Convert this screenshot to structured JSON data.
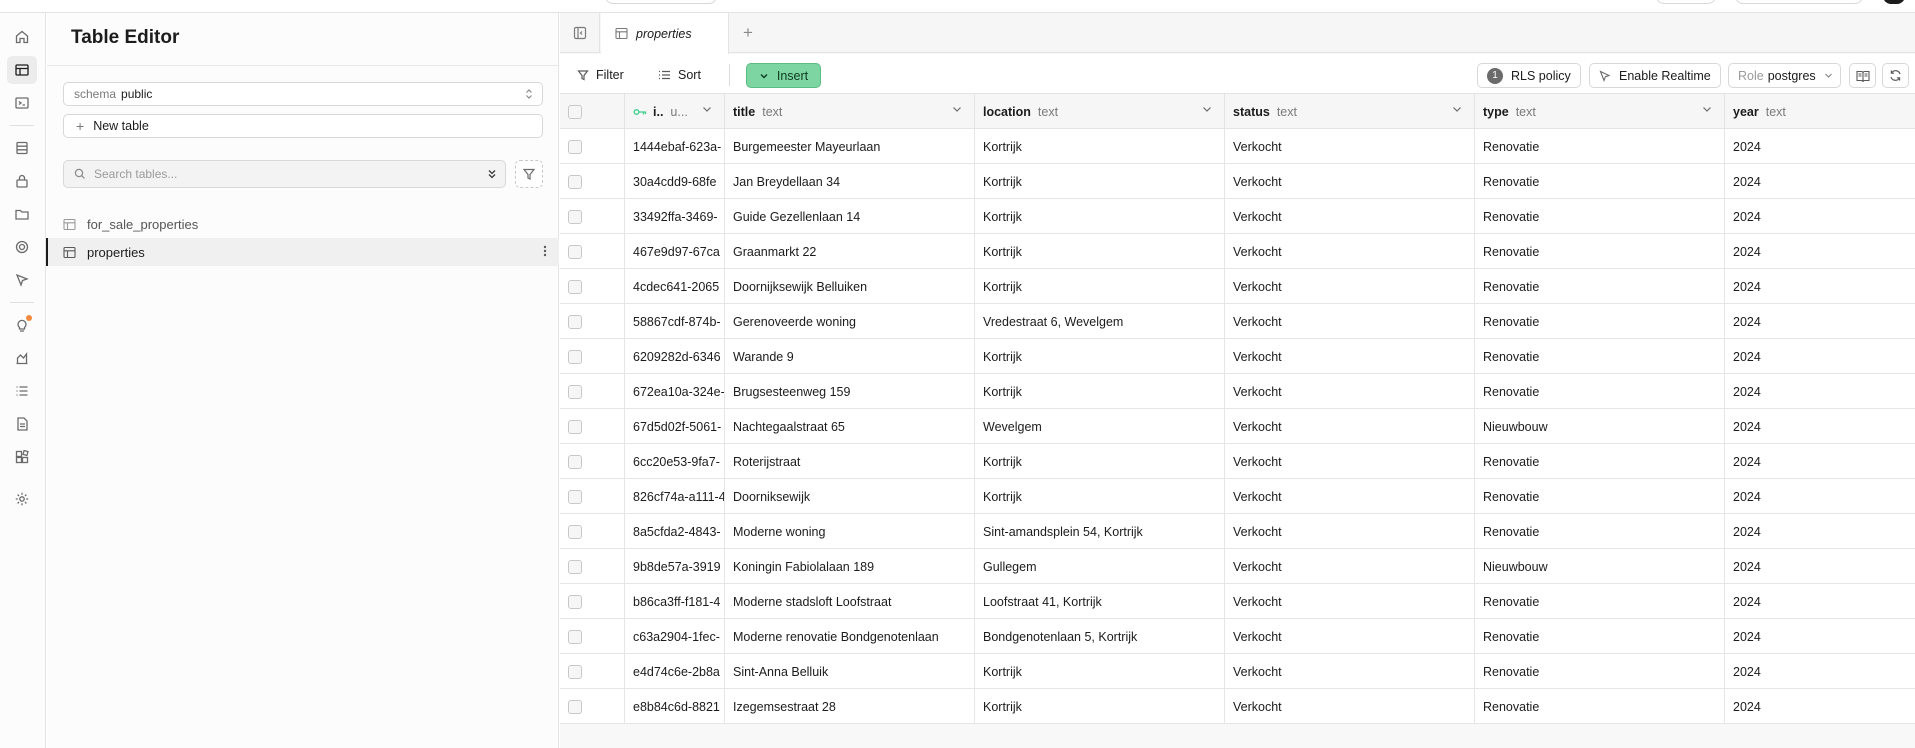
{
  "sidebar": {
    "title": "Table Editor",
    "schema_label": "schema",
    "schema_value": "public",
    "new_table_label": "New table",
    "search_placeholder": "Search tables...",
    "tables": [
      {
        "name": "for_sale_properties",
        "active": false
      },
      {
        "name": "properties",
        "active": true
      }
    ]
  },
  "rail": {
    "icons": [
      "home-icon",
      "table-editor-icon",
      "sql-editor-icon",
      "database-icon",
      "auth-icon",
      "storage-icon",
      "edge-functions-icon",
      "realtime-icon",
      "advisors-icon",
      "reports-icon",
      "logs-icon",
      "api-docs-icon",
      "integrations-icon",
      "settings-icon"
    ]
  },
  "tabs": [
    {
      "label": "properties"
    }
  ],
  "toolbar": {
    "filter_label": "Filter",
    "sort_label": "Sort",
    "insert_label": "Insert",
    "rls_count": "1",
    "rls_label": "RLS policy",
    "realtime_label": "Enable Realtime",
    "role_label": "Role",
    "role_value": "postgres"
  },
  "grid": {
    "columns": [
      {
        "name": "i..",
        "type": "u..."
      },
      {
        "name": "title",
        "type": "text"
      },
      {
        "name": "location",
        "type": "text"
      },
      {
        "name": "status",
        "type": "text"
      },
      {
        "name": "type",
        "type": "text"
      },
      {
        "name": "year",
        "type": "text"
      }
    ],
    "rows": [
      [
        "1444ebaf-623a-",
        "Burgemeester Mayeurlaan",
        "Kortrijk",
        "Verkocht",
        "Renovatie",
        "2024"
      ],
      [
        "30a4cdd9-68fe",
        "Jan Breydellaan 34",
        "Kortrijk",
        "Verkocht",
        "Renovatie",
        "2024"
      ],
      [
        "33492ffa-3469-",
        "Guide Gezellenlaan 14",
        "Kortrijk",
        "Verkocht",
        "Renovatie",
        "2024"
      ],
      [
        "467e9d97-67ca",
        "Graanmarkt 22",
        "Kortrijk",
        "Verkocht",
        "Renovatie",
        "2024"
      ],
      [
        "4cdec641-2065",
        "Doornijksewijk Belluiken",
        "Kortrijk",
        "Verkocht",
        "Renovatie",
        "2024"
      ],
      [
        "58867cdf-874b-",
        "Gerenoveerde woning",
        "Vredestraat 6, Wevelgem",
        "Verkocht",
        "Renovatie",
        "2024"
      ],
      [
        "6209282d-6346",
        "Warande 9",
        "Kortrijk",
        "Verkocht",
        "Renovatie",
        "2024"
      ],
      [
        "672ea10a-324e-",
        "Brugsesteenweg 159",
        "Kortrijk",
        "Verkocht",
        "Renovatie",
        "2024"
      ],
      [
        "67d5d02f-5061-",
        "Nachtegaalstraat 65",
        "Wevelgem",
        "Verkocht",
        "Nieuwbouw",
        "2024"
      ],
      [
        "6cc20e53-9fa7-",
        "Roterijstraat",
        "Kortrijk",
        "Verkocht",
        "Renovatie",
        "2024"
      ],
      [
        "826cf74a-a111-4",
        "Doorniksewijk",
        "Kortrijk",
        "Verkocht",
        "Renovatie",
        "2024"
      ],
      [
        "8a5cfda2-4843-",
        "Moderne woning",
        "Sint-amandsplein 54, Kortrijk",
        "Verkocht",
        "Renovatie",
        "2024"
      ],
      [
        "9b8de57a-3919",
        "Koningin Fabiolalaan 189",
        "Gullegem",
        "Verkocht",
        "Nieuwbouw",
        "2024"
      ],
      [
        "b86ca3ff-f181-4",
        "Moderne stadsloft Loofstraat",
        "Loofstraat 41, Kortrijk",
        "Verkocht",
        "Renovatie",
        "2024"
      ],
      [
        "c63a2904-1fec-",
        "Moderne renovatie Bondgenotenlaan",
        "Bondgenotenlaan 5, Kortrijk",
        "Verkocht",
        "Renovatie",
        "2024"
      ],
      [
        "e4d74c6e-2b8a",
        "Sint-Anna Belluik",
        "Kortrijk",
        "Verkocht",
        "Renovatie",
        "2024"
      ],
      [
        "e8b84c6d-8821",
        "Izegemsestraat 28",
        "Kortrijk",
        "Verkocht",
        "Renovatie",
        "2024"
      ]
    ]
  },
  "colors": {
    "accent": "#3ecf8e",
    "insert_bg": "#7dd6a1",
    "notification_dot": "#f3893f"
  }
}
